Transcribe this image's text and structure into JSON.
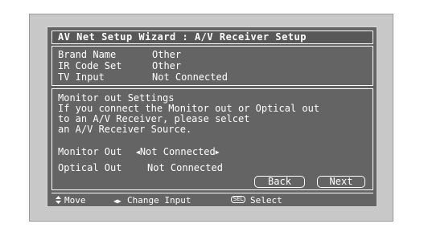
{
  "title": "AV Net Setup Wizard : A/V Receiver Setup",
  "info": {
    "brand_name_label": "Brand Name",
    "brand_name_value": "Other",
    "ir_code_set_label": "IR Code Set",
    "ir_code_set_value": "Other",
    "tv_input_label": "TV Input",
    "tv_input_value": "Not Connected"
  },
  "monitor_settings": {
    "heading": "Monitor out Settings",
    "description_lines": [
      "If you connect the Monitor out or Optical out",
      "to an A/V Receiver, please selcet",
      "an A/V Receiver Source."
    ],
    "monitor_out_label": "Monitor Out",
    "monitor_out_value": "Not Connected",
    "optical_out_label": "Optical Out",
    "optical_out_value": "Not Connected"
  },
  "buttons": {
    "back": "Back",
    "next": "Next"
  },
  "legend": {
    "move": "Move",
    "change_input": "Change Input",
    "sel_key": "SEL",
    "select": "Select"
  },
  "colors": {
    "screen_background": "#646464",
    "frame_background": "#c8c8c8",
    "text": "#ffffff"
  }
}
